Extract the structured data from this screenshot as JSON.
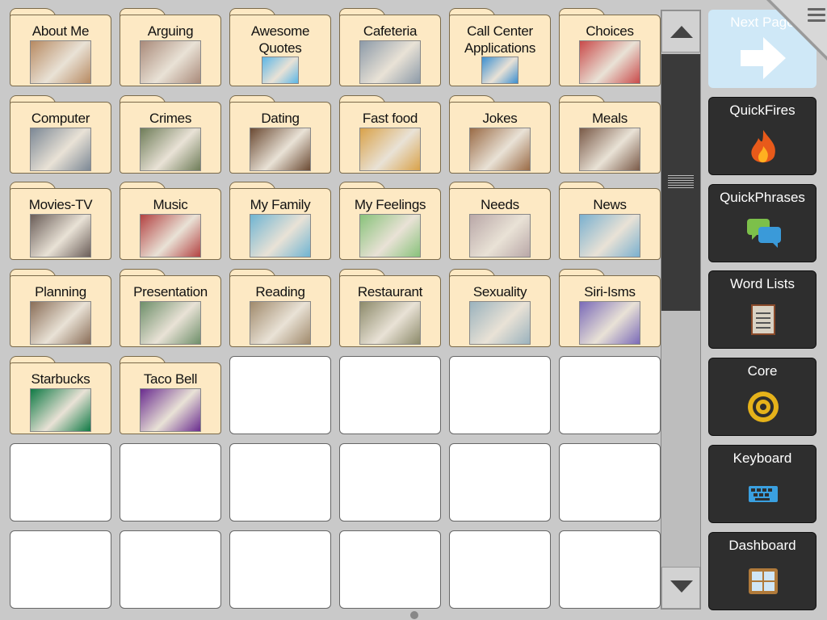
{
  "folders": [
    {
      "label": "About Me",
      "icon": "person-photo-icon",
      "color": "#b78a62"
    },
    {
      "label": "Arguing",
      "icon": "arguing-people-icon",
      "color": "#a98a7a"
    },
    {
      "label": "Awesome\nQuotes",
      "icon": "smiley-quote-icon",
      "color": "#5bb6e6"
    },
    {
      "label": "Cafeteria",
      "icon": "cafeteria-photo-icon",
      "color": "#8c9aa8"
    },
    {
      "label": "Call Center\nApplications",
      "icon": "headset-globe-icon",
      "color": "#3b8fd0"
    },
    {
      "label": "Choices",
      "icon": "pointing-finger-icon",
      "color": "#c94a4a"
    },
    {
      "label": "Computer",
      "icon": "computer-photo-icon",
      "color": "#7c8895"
    },
    {
      "label": "Crimes",
      "icon": "police-crime-icon",
      "color": "#6f7d59"
    },
    {
      "label": "Dating",
      "icon": "dating-photo-icon",
      "color": "#6b4a33"
    },
    {
      "label": "Fast food",
      "icon": "fast-food-counter-icon",
      "color": "#d9a24a"
    },
    {
      "label": "Jokes",
      "icon": "laughing-people-icon",
      "color": "#9a6b46"
    },
    {
      "label": "Meals",
      "icon": "meal-table-icon",
      "color": "#7a5a48"
    },
    {
      "label": "Movies-TV",
      "icon": "watching-tv-icon",
      "color": "#6a5d58"
    },
    {
      "label": "Music",
      "icon": "music-room-icon",
      "color": "#b34242"
    },
    {
      "label": "My Family",
      "icon": "family-icon",
      "color": "#6fb4d2"
    },
    {
      "label": "My Feelings",
      "icon": "faces-feelings-icon",
      "color": "#88c27a"
    },
    {
      "label": "Needs",
      "icon": "needs-collage-icon",
      "color": "#b9a7a7"
    },
    {
      "label": "News",
      "icon": "news-reading-icon",
      "color": "#7ab0cf"
    },
    {
      "label": "Planning",
      "icon": "planning-photo-icon",
      "color": "#8a6e58"
    },
    {
      "label": "Presentation",
      "icon": "presentation-icon",
      "color": "#6e8f6a"
    },
    {
      "label": "Reading",
      "icon": "library-shelves-icon",
      "color": "#a08a6c"
    },
    {
      "label": "Restaurant",
      "icon": "restaurant-photo-icon",
      "color": "#8c8a6a"
    },
    {
      "label": "Sexuality",
      "icon": "sexuality-collage-icon",
      "color": "#9ab2bd"
    },
    {
      "label": "Siri-Isms",
      "icon": "siri-microphone-icon",
      "color": "#7a6ab8"
    },
    {
      "label": "Starbucks",
      "icon": "starbucks-logo-icon",
      "color": "#0f7a45"
    },
    {
      "label": "Taco Bell",
      "icon": "taco-bell-logo-icon",
      "color": "#6a2c8f"
    }
  ],
  "empty_cells": 16,
  "sidebar": {
    "next_page": {
      "label": "Next Page",
      "icon": "arrow-right-icon"
    },
    "items": [
      {
        "label": "QuickFires",
        "icon": "flame-icon",
        "color": "#e85a1a"
      },
      {
        "label": "QuickPhrases",
        "icon": "speech-bubbles-icon",
        "color": "#3a9ad9"
      },
      {
        "label": "Word Lists",
        "icon": "notepad-list-icon",
        "color": "#d9d2c4"
      },
      {
        "label": "Core",
        "icon": "target-rings-icon",
        "color": "#e5b21a"
      },
      {
        "label": "Keyboard",
        "icon": "keyboard-icon",
        "color": "#3aa0e0"
      },
      {
        "label": "Dashboard",
        "icon": "dashboard-grid-icon",
        "color": "#b07a3a"
      }
    ]
  },
  "menu_icon": "hamburger-menu-icon"
}
